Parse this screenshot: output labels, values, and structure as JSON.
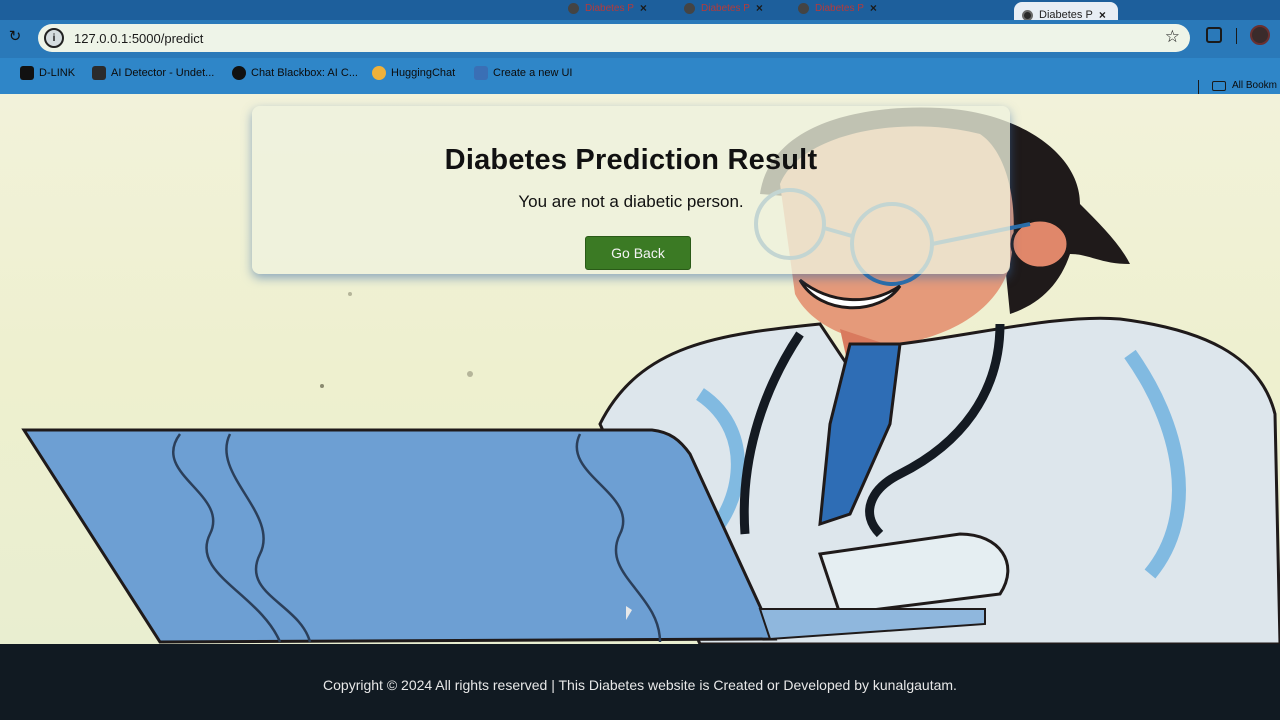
{
  "browser": {
    "tabs": [
      {
        "label": "",
        "active": false
      },
      {
        "label": "Diabetes P",
        "active": false
      },
      {
        "label": "Diabetes P",
        "active": false
      },
      {
        "label": "Diabetes P",
        "active": false
      },
      {
        "label": "Diabetes P",
        "active": true
      }
    ],
    "url": "127.0.0.1:5000/predict",
    "bookmarks": [
      {
        "label": "D-LINK",
        "color": "#111111"
      },
      {
        "label": "AI Detector - Undet...",
        "color": "#2b2b2b"
      },
      {
        "label": "Chat Blackbox: AI C...",
        "color": "#111111"
      },
      {
        "label": "HuggingChat",
        "color": "#f0b13a"
      },
      {
        "label": "Create a new UI",
        "color": "#3a6fb5"
      }
    ],
    "all_bookmarks_label": "All Bookm"
  },
  "result": {
    "title": "Diabetes Prediction Result",
    "message": "You are not a diabetic person.",
    "button_label": "Go Back"
  },
  "footer": {
    "text": "Copyright © 2024 All rights reserved | This Diabetes website is Created or Developed by kunalgautam."
  },
  "colors": {
    "button": "#3b7a24",
    "chrome": "#2a79b9"
  }
}
